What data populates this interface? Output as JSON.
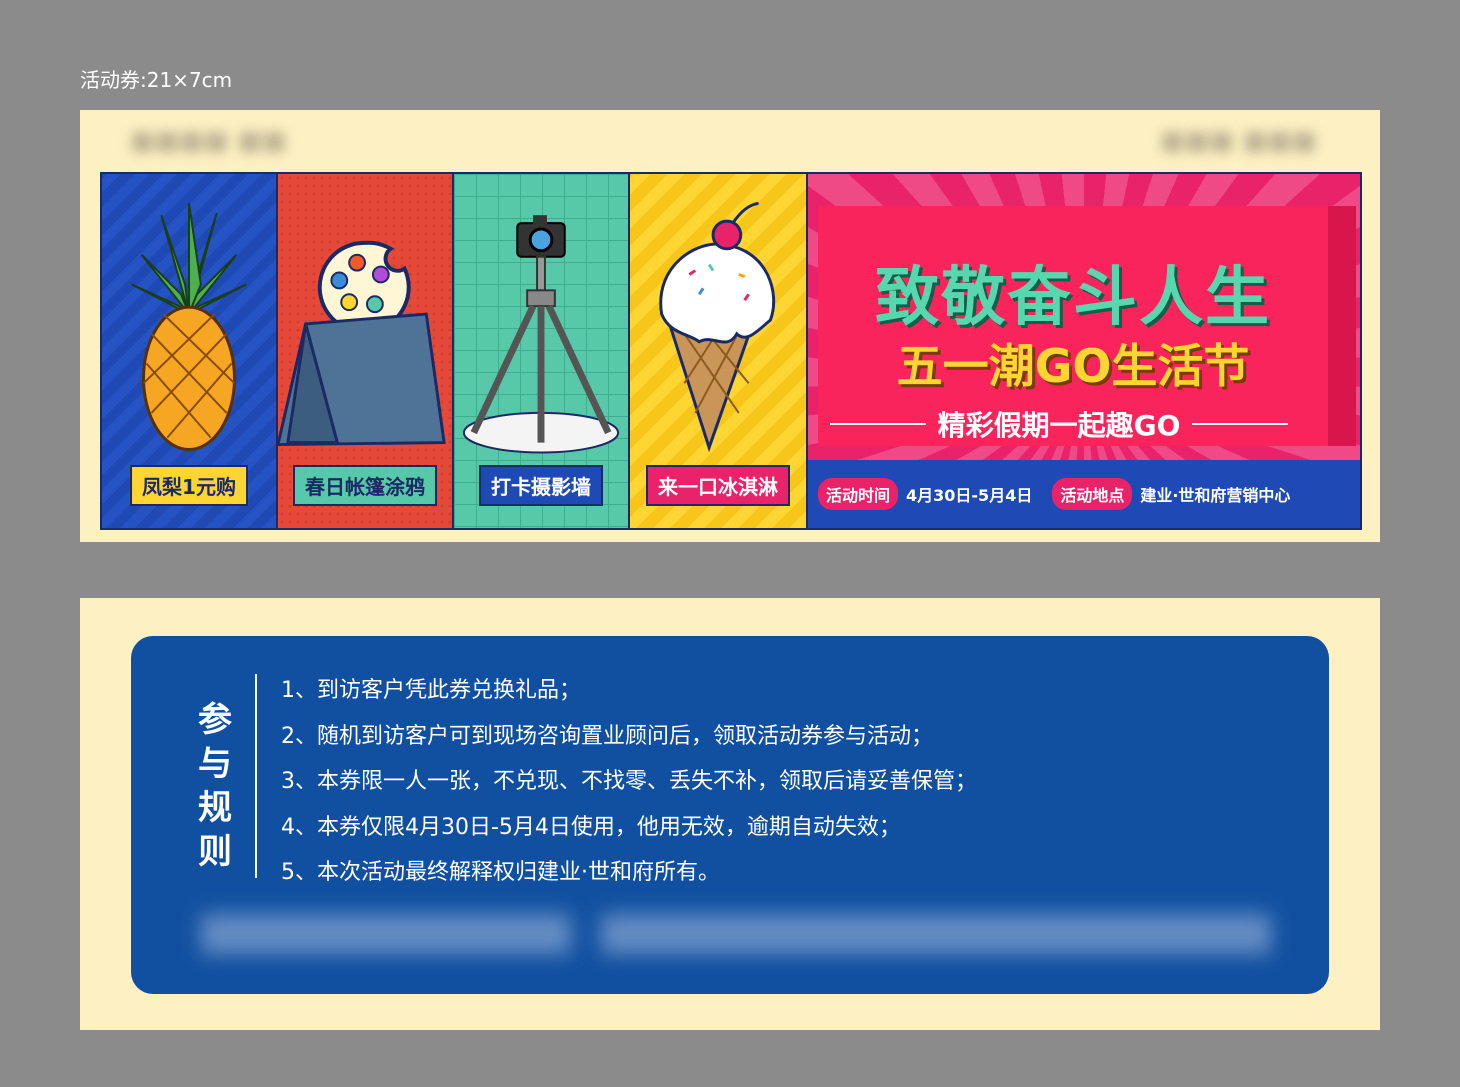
{
  "size_label": "活动券:21×7cm",
  "front": {
    "panels": [
      {
        "tag": "凤梨1元购",
        "icon": "pineapple-icon"
      },
      {
        "tag": "春日帐篷涂鸦",
        "icon": "tent-palette-icon"
      },
      {
        "tag": "打卡摄影墙",
        "icon": "camera-tripod-icon"
      },
      {
        "tag": "来一口冰淇淋",
        "icon": "ice-cream-icon"
      }
    ],
    "promo": {
      "title1": "致敬奋斗人生",
      "title2": "五一潮GO生活节",
      "subtitle": "精彩假期一起趣GO"
    },
    "info": {
      "time_label": "活动时间",
      "time_value": "4月30日-5月4日",
      "place_label": "活动地点",
      "place_value": "建业·世和府营销中心"
    }
  },
  "back": {
    "rules_title": "参与规则",
    "rules": [
      "1、到访客户凭此券兑换礼品；",
      "2、随机到访客户可到现场咨询置业顾问后，领取活动券参与活动；",
      "3、本券限一人一张，不兑现、不找零、丢失不补，领取后请妥善保管；",
      "4、本券仅限4月30日-5月4日使用，他用无效，逾期自动失效；",
      "5、本次活动最终解释权归建业·世和府所有。"
    ]
  },
  "colors": {
    "background": "#8b8b8b",
    "card": "#fdf0c2",
    "blue": "#1f49b4",
    "pink": "#e9236a",
    "yellow": "#ffd531",
    "teal": "#57c8a8",
    "rules_bg": "#1150a0"
  }
}
